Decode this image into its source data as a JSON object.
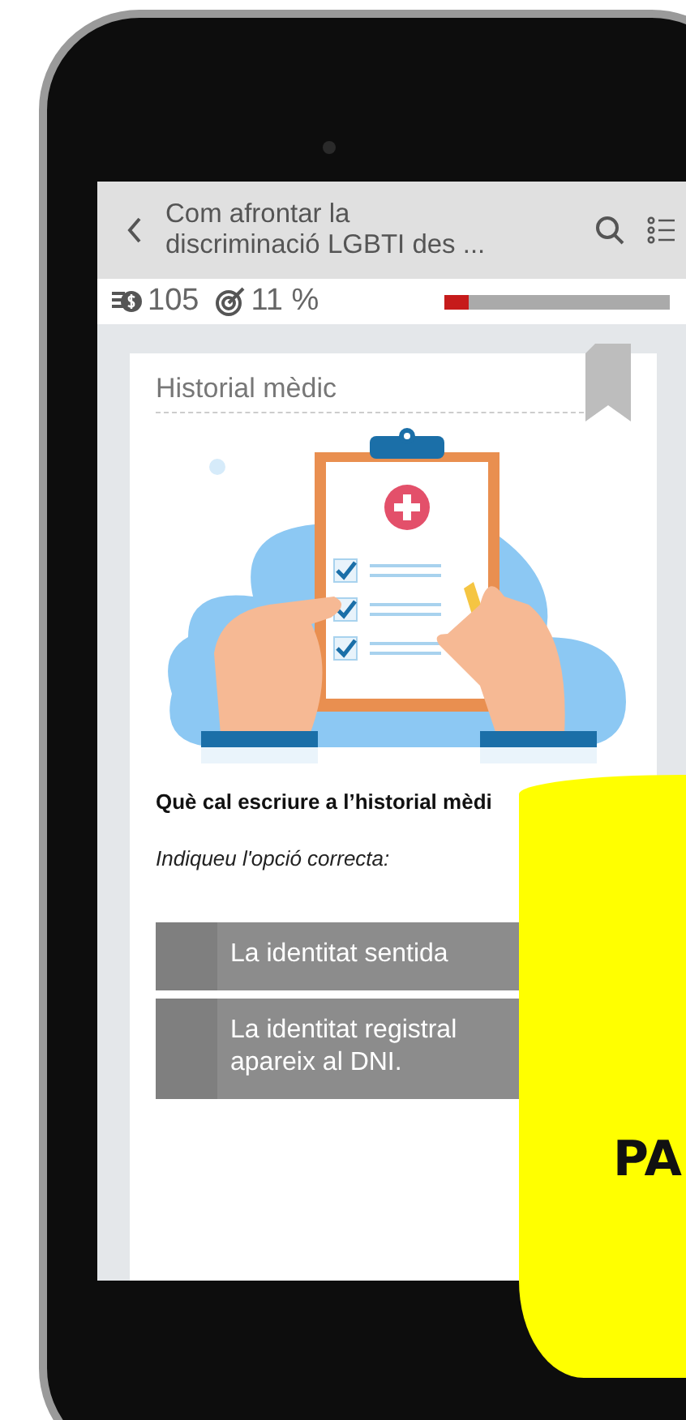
{
  "header": {
    "title": "Com afrontar la discriminació LGBTI des ..."
  },
  "stats": {
    "coins": "105",
    "progress_text": "11 %",
    "progress": {
      "level": 0.11
    }
  },
  "card": {
    "title": "Historial mèdic",
    "question": "Què cal escriure a l’historial mèdi",
    "instruction": "Indiqueu l'opció correcta:",
    "options": [
      {
        "lines": [
          "La identitat sentida"
        ]
      },
      {
        "lines": [
          "La identitat registral",
          "apareix al DNI."
        ]
      }
    ]
  },
  "overlay": {
    "text": "PA"
  }
}
